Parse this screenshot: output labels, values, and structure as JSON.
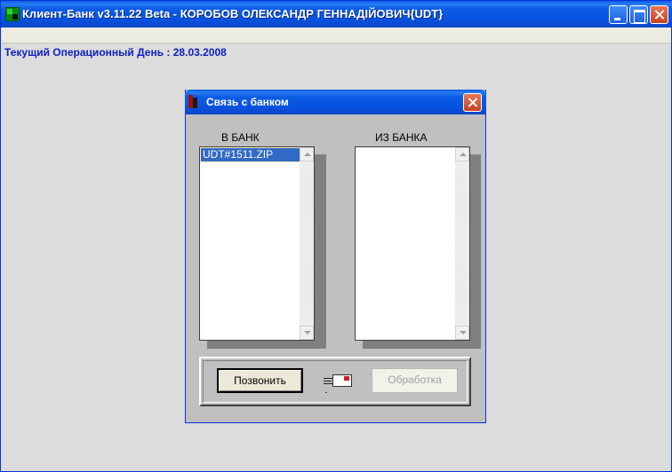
{
  "window": {
    "title": "Клиент-Банк v3.11.22 Beta - КОРОБОВ ОЛЕКСАНДР ГЕННАДІЙОВИЧ{UDT}"
  },
  "status": {
    "operational_day": "Текущий Операционный День : 28.03.2008"
  },
  "dialog": {
    "title": "Связь с банком",
    "to_bank_label": "В БАНК",
    "from_bank_label": "ИЗ БАНКА",
    "to_bank_items": [
      "UDT#1511.ZIP"
    ],
    "from_bank_items": [],
    "call_button": "Позвонить",
    "process_button": "Обработка",
    "process_enabled": false
  },
  "colors": {
    "title_bar": "#0a5ce6",
    "selection": "#316ac5",
    "op_day_text": "#1020c0",
    "dialog_bg": "#c0c0c0"
  },
  "icons": [
    "app-icon",
    "minimize-icon",
    "maximize-icon",
    "close-icon",
    "bank-icon",
    "mail-icon"
  ]
}
